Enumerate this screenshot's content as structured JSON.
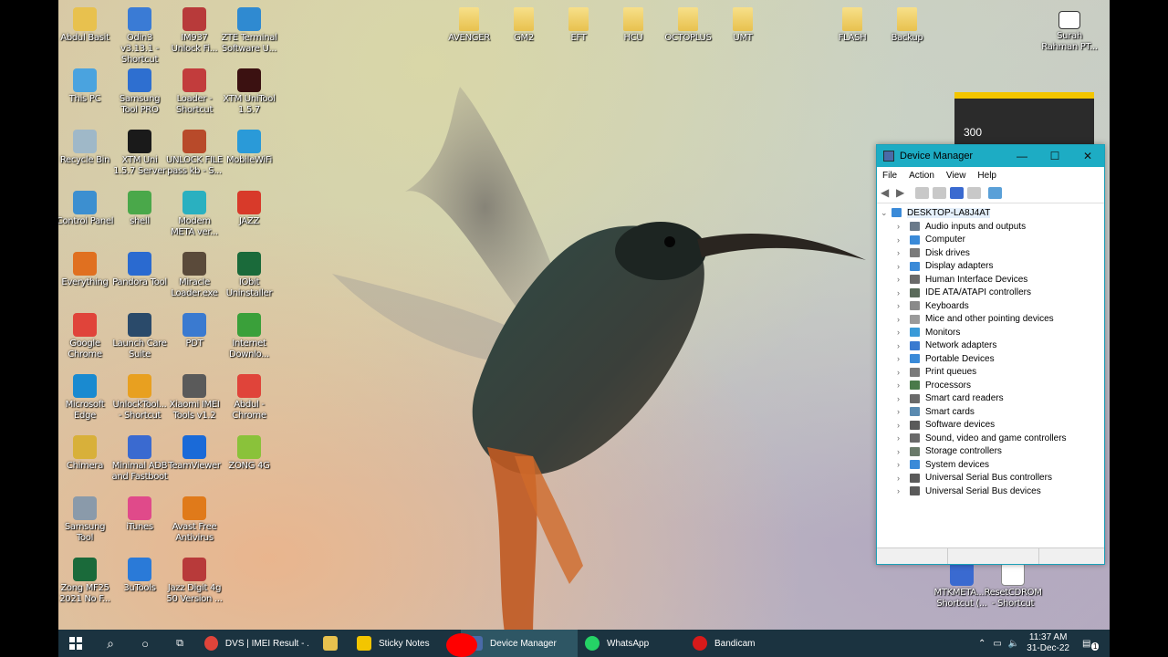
{
  "desktop_icons": [
    {
      "label": "Abdul Basit",
      "color": "#e8c14e"
    },
    {
      "label": "Odin3 v3.13.1 - Shortcut",
      "color": "#3a7bd5"
    },
    {
      "label": "IM937 Unlock Fi...",
      "color": "#b83a3a"
    },
    {
      "label": "ZTE Terminal Software U...",
      "color": "#2f8ad1"
    },
    {
      "label": "This PC",
      "color": "#4aa3df"
    },
    {
      "label": "Samsung Tool PRO",
      "color": "#2e6fd0"
    },
    {
      "label": "Loader - Shortcut",
      "color": "#c23c3c"
    },
    {
      "label": "XTM UniTool 1.5.7",
      "color": "#3b1111"
    },
    {
      "label": "Recycle Bin",
      "color": "#9fb8c8"
    },
    {
      "label": "XTM Uni 1.5.7 Server",
      "color": "#1a1a1a"
    },
    {
      "label": "UNLOCK FILE pass kb - S...",
      "color": "#b84a2a"
    },
    {
      "label": "MobileWiFi",
      "color": "#2a9ad8"
    },
    {
      "label": "Control Panel",
      "color": "#3c8fd0"
    },
    {
      "label": "shell",
      "color": "#4aa84a"
    },
    {
      "label": "Modem META ver...",
      "color": "#2ab0c0"
    },
    {
      "label": "JAZZ",
      "color": "#d83a2a"
    },
    {
      "label": "Everything",
      "color": "#e07020"
    },
    {
      "label": "Pandora Tool",
      "color": "#2a6ad0"
    },
    {
      "label": "Miracle Loader.exe",
      "color": "#5a4a3a"
    },
    {
      "label": "IObit Uninstaller",
      "color": "#1a6a3a"
    },
    {
      "label": "Google Chrome",
      "color": "#e0443a"
    },
    {
      "label": "Launch Care Suite",
      "color": "#2a4a6a"
    },
    {
      "label": "PDT",
      "color": "#3a7ad0"
    },
    {
      "label": "Internet Downlo...",
      "color": "#3aa03a"
    },
    {
      "label": "Microsoft Edge",
      "color": "#1a8ad0"
    },
    {
      "label": "UnlockTool... - Shortcut",
      "color": "#e8a020"
    },
    {
      "label": "Xiaomi IMEI Tools v1.2",
      "color": "#5a5a5a"
    },
    {
      "label": "Abdul - Chrome",
      "color": "#e0443a"
    },
    {
      "label": "Chimera",
      "color": "#d8b03a"
    },
    {
      "label": "Minimal ADB and Fastboot",
      "color": "#3a6ad0"
    },
    {
      "label": "TeamViewer",
      "color": "#1a6ad8"
    },
    {
      "label": "ZONG 4G",
      "color": "#8ac23a"
    },
    {
      "label": "Samsung Tool",
      "color": "#8a9aaa"
    },
    {
      "label": "iTunes",
      "color": "#e04a8a"
    },
    {
      "label": "Avast Free Antivirus",
      "color": "#e07a1a"
    },
    {
      "label": "",
      "color": "#000000"
    },
    {
      "label": "Zong MF25 2021 No F...",
      "color": "#1a6a3a"
    },
    {
      "label": "3uTools",
      "color": "#2a7ad8"
    },
    {
      "label": "Jazz Digit 4g 50 Version ...",
      "color": "#b83a3a"
    }
  ],
  "top_folders": [
    "AVENGER",
    "GM2",
    "EFT",
    "HCU",
    "OCTOPLUS",
    "UMT",
    "FLASH",
    "Backup"
  ],
  "top_right_icon": {
    "label": "Surah Rahman PT..."
  },
  "bottom_right_icons": [
    {
      "label": "MTKMETA... - Shortcut (..."
    },
    {
      "label": "ResetCDROM - Shortcut"
    }
  ],
  "sticky_note": {
    "text": "300"
  },
  "device_manager": {
    "title": "Device Manager",
    "minimize": "—",
    "maximize": "☐",
    "close": "✕",
    "menu": [
      "File",
      "Action",
      "View",
      "Help"
    ],
    "root": "DESKTOP-LA8J4AT",
    "nodes": [
      {
        "label": "Audio inputs and outputs",
        "color": "#6a7a8a"
      },
      {
        "label": "Computer",
        "color": "#3a8ad8"
      },
      {
        "label": "Disk drives",
        "color": "#7a7a7a"
      },
      {
        "label": "Display adapters",
        "color": "#3a8ad8"
      },
      {
        "label": "Human Interface Devices",
        "color": "#6a6a6a"
      },
      {
        "label": "IDE ATA/ATAPI controllers",
        "color": "#5a6a5a"
      },
      {
        "label": "Keyboards",
        "color": "#8a8a8a"
      },
      {
        "label": "Mice and other pointing devices",
        "color": "#9a9a9a"
      },
      {
        "label": "Monitors",
        "color": "#3a9ad8"
      },
      {
        "label": "Network adapters",
        "color": "#3a7ad0"
      },
      {
        "label": "Portable Devices",
        "color": "#3a8ad8"
      },
      {
        "label": "Print queues",
        "color": "#7a7a7a"
      },
      {
        "label": "Processors",
        "color": "#4a7a4a"
      },
      {
        "label": "Smart card readers",
        "color": "#6a6a6a"
      },
      {
        "label": "Smart cards",
        "color": "#5a8ab0"
      },
      {
        "label": "Software devices",
        "color": "#5a5a5a"
      },
      {
        "label": "Sound, video and game controllers",
        "color": "#6a6a6a"
      },
      {
        "label": "Storage controllers",
        "color": "#6a7a6a"
      },
      {
        "label": "System devices",
        "color": "#3a8ad8"
      },
      {
        "label": "Universal Serial Bus controllers",
        "color": "#5a5a5a"
      },
      {
        "label": "Universal Serial Bus devices",
        "color": "#5a5a5a"
      }
    ]
  },
  "taskbar": {
    "apps": [
      {
        "label": "DVS | IMEI Result - ...",
        "color": "#e0443a"
      },
      {
        "label": "",
        "color": "#e8c14e"
      },
      {
        "label": "Sticky Notes",
        "color": "#f3c500"
      },
      {
        "label": "Device Manager",
        "color": "#4a6aa8"
      },
      {
        "label": "WhatsApp",
        "color": "#25d366"
      },
      {
        "label": "Bandicam",
        "color": "#d81a1a"
      }
    ],
    "time": "11:37 AM",
    "date": "31-Dec-22",
    "notification_count": "1"
  }
}
